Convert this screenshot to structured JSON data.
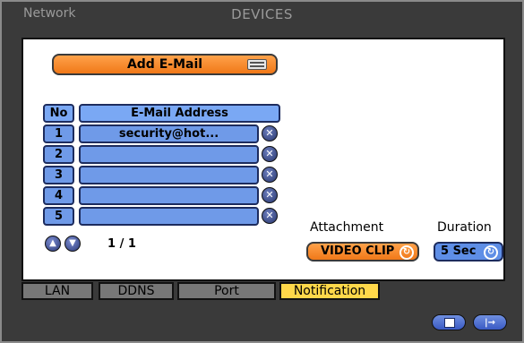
{
  "window": {
    "section": "Network",
    "title": "DEVICES"
  },
  "email": {
    "add_label": "Add E-Mail",
    "headers": {
      "no": "No",
      "address": "E-Mail Address"
    },
    "rows": [
      {
        "no": "1",
        "address": "security@hot..."
      },
      {
        "no": "2",
        "address": ""
      },
      {
        "no": "3",
        "address": ""
      },
      {
        "no": "4",
        "address": ""
      },
      {
        "no": "5",
        "address": ""
      }
    ],
    "page": "1 / 1"
  },
  "attachment": {
    "label": "Attachment",
    "value": "VIDEO CLIP"
  },
  "duration": {
    "label": "Duration",
    "value": "5 Sec"
  },
  "tabs": [
    {
      "label": "LAN",
      "active": false
    },
    {
      "label": "DDNS",
      "active": false
    },
    {
      "label": "Port",
      "active": false
    },
    {
      "label": "Notification",
      "active": true
    }
  ],
  "icons": {
    "keyboard": "keyboard-icon",
    "delete": "delete-icon",
    "up": "up-arrow-icon",
    "down": "down-arrow-icon",
    "refresh": "refresh-icon",
    "save": "save-icon",
    "exit": "exit-icon"
  },
  "colors": {
    "accent_orange": "#f07818",
    "accent_blue": "#6f9ae8",
    "active_tab": "#ffd84a",
    "window_bg": "#3a3a3a"
  }
}
